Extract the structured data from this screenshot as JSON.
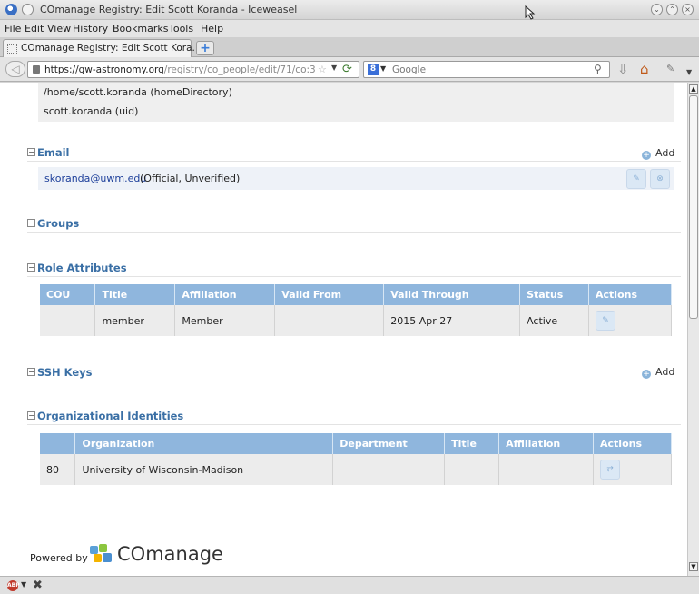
{
  "window": {
    "title": "COmanage Registry: Edit Scott Koranda - Iceweasel"
  },
  "menubar": {
    "items": [
      "File",
      "Edit",
      "View",
      "History",
      "Bookmarks",
      "Tools",
      "Help"
    ]
  },
  "tabs": [
    {
      "label": "COmanage Registry: Edit Scott Kora..."
    }
  ],
  "navbar": {
    "url_host": "https://gw-astronomy.org",
    "url_path": "/registry/co_people/edit/71/co:3",
    "search_engine": "Google"
  },
  "identifiers": [
    {
      "text": "/home/scott.koranda (homeDirectory)"
    },
    {
      "text": "scott.koranda (uid)"
    }
  ],
  "email": {
    "title": "Email",
    "add_label": "Add",
    "address": "skoranda@uwm.edu",
    "meta": "(Official, Unverified)"
  },
  "groups": {
    "title": "Groups"
  },
  "role_attributes": {
    "title": "Role Attributes",
    "columns": [
      "COU",
      "Title",
      "Affiliation",
      "Valid From",
      "Valid Through",
      "Status",
      "Actions"
    ],
    "rows": [
      {
        "cou": "",
        "title": "member",
        "affiliation": "Member",
        "valid_from": "",
        "valid_through": "2015 Apr 27",
        "status": "Active"
      }
    ]
  },
  "ssh_keys": {
    "title": "SSH Keys",
    "add_label": "Add"
  },
  "org_identities": {
    "title": "Organizational Identities",
    "columns": [
      "",
      "Organization",
      "Department",
      "Title",
      "Affiliation",
      "Actions"
    ],
    "rows": [
      {
        "id": "80",
        "organization": "University of Wisconsin-Madison",
        "department": "",
        "title": "",
        "affiliation": ""
      }
    ]
  },
  "footer": {
    "powered_by": "Powered by",
    "brand": "COmanage"
  },
  "colors": {
    "section_title": "#3a6fa5",
    "table_header": "#8fb6dd",
    "email_link": "#1d3f9a"
  }
}
